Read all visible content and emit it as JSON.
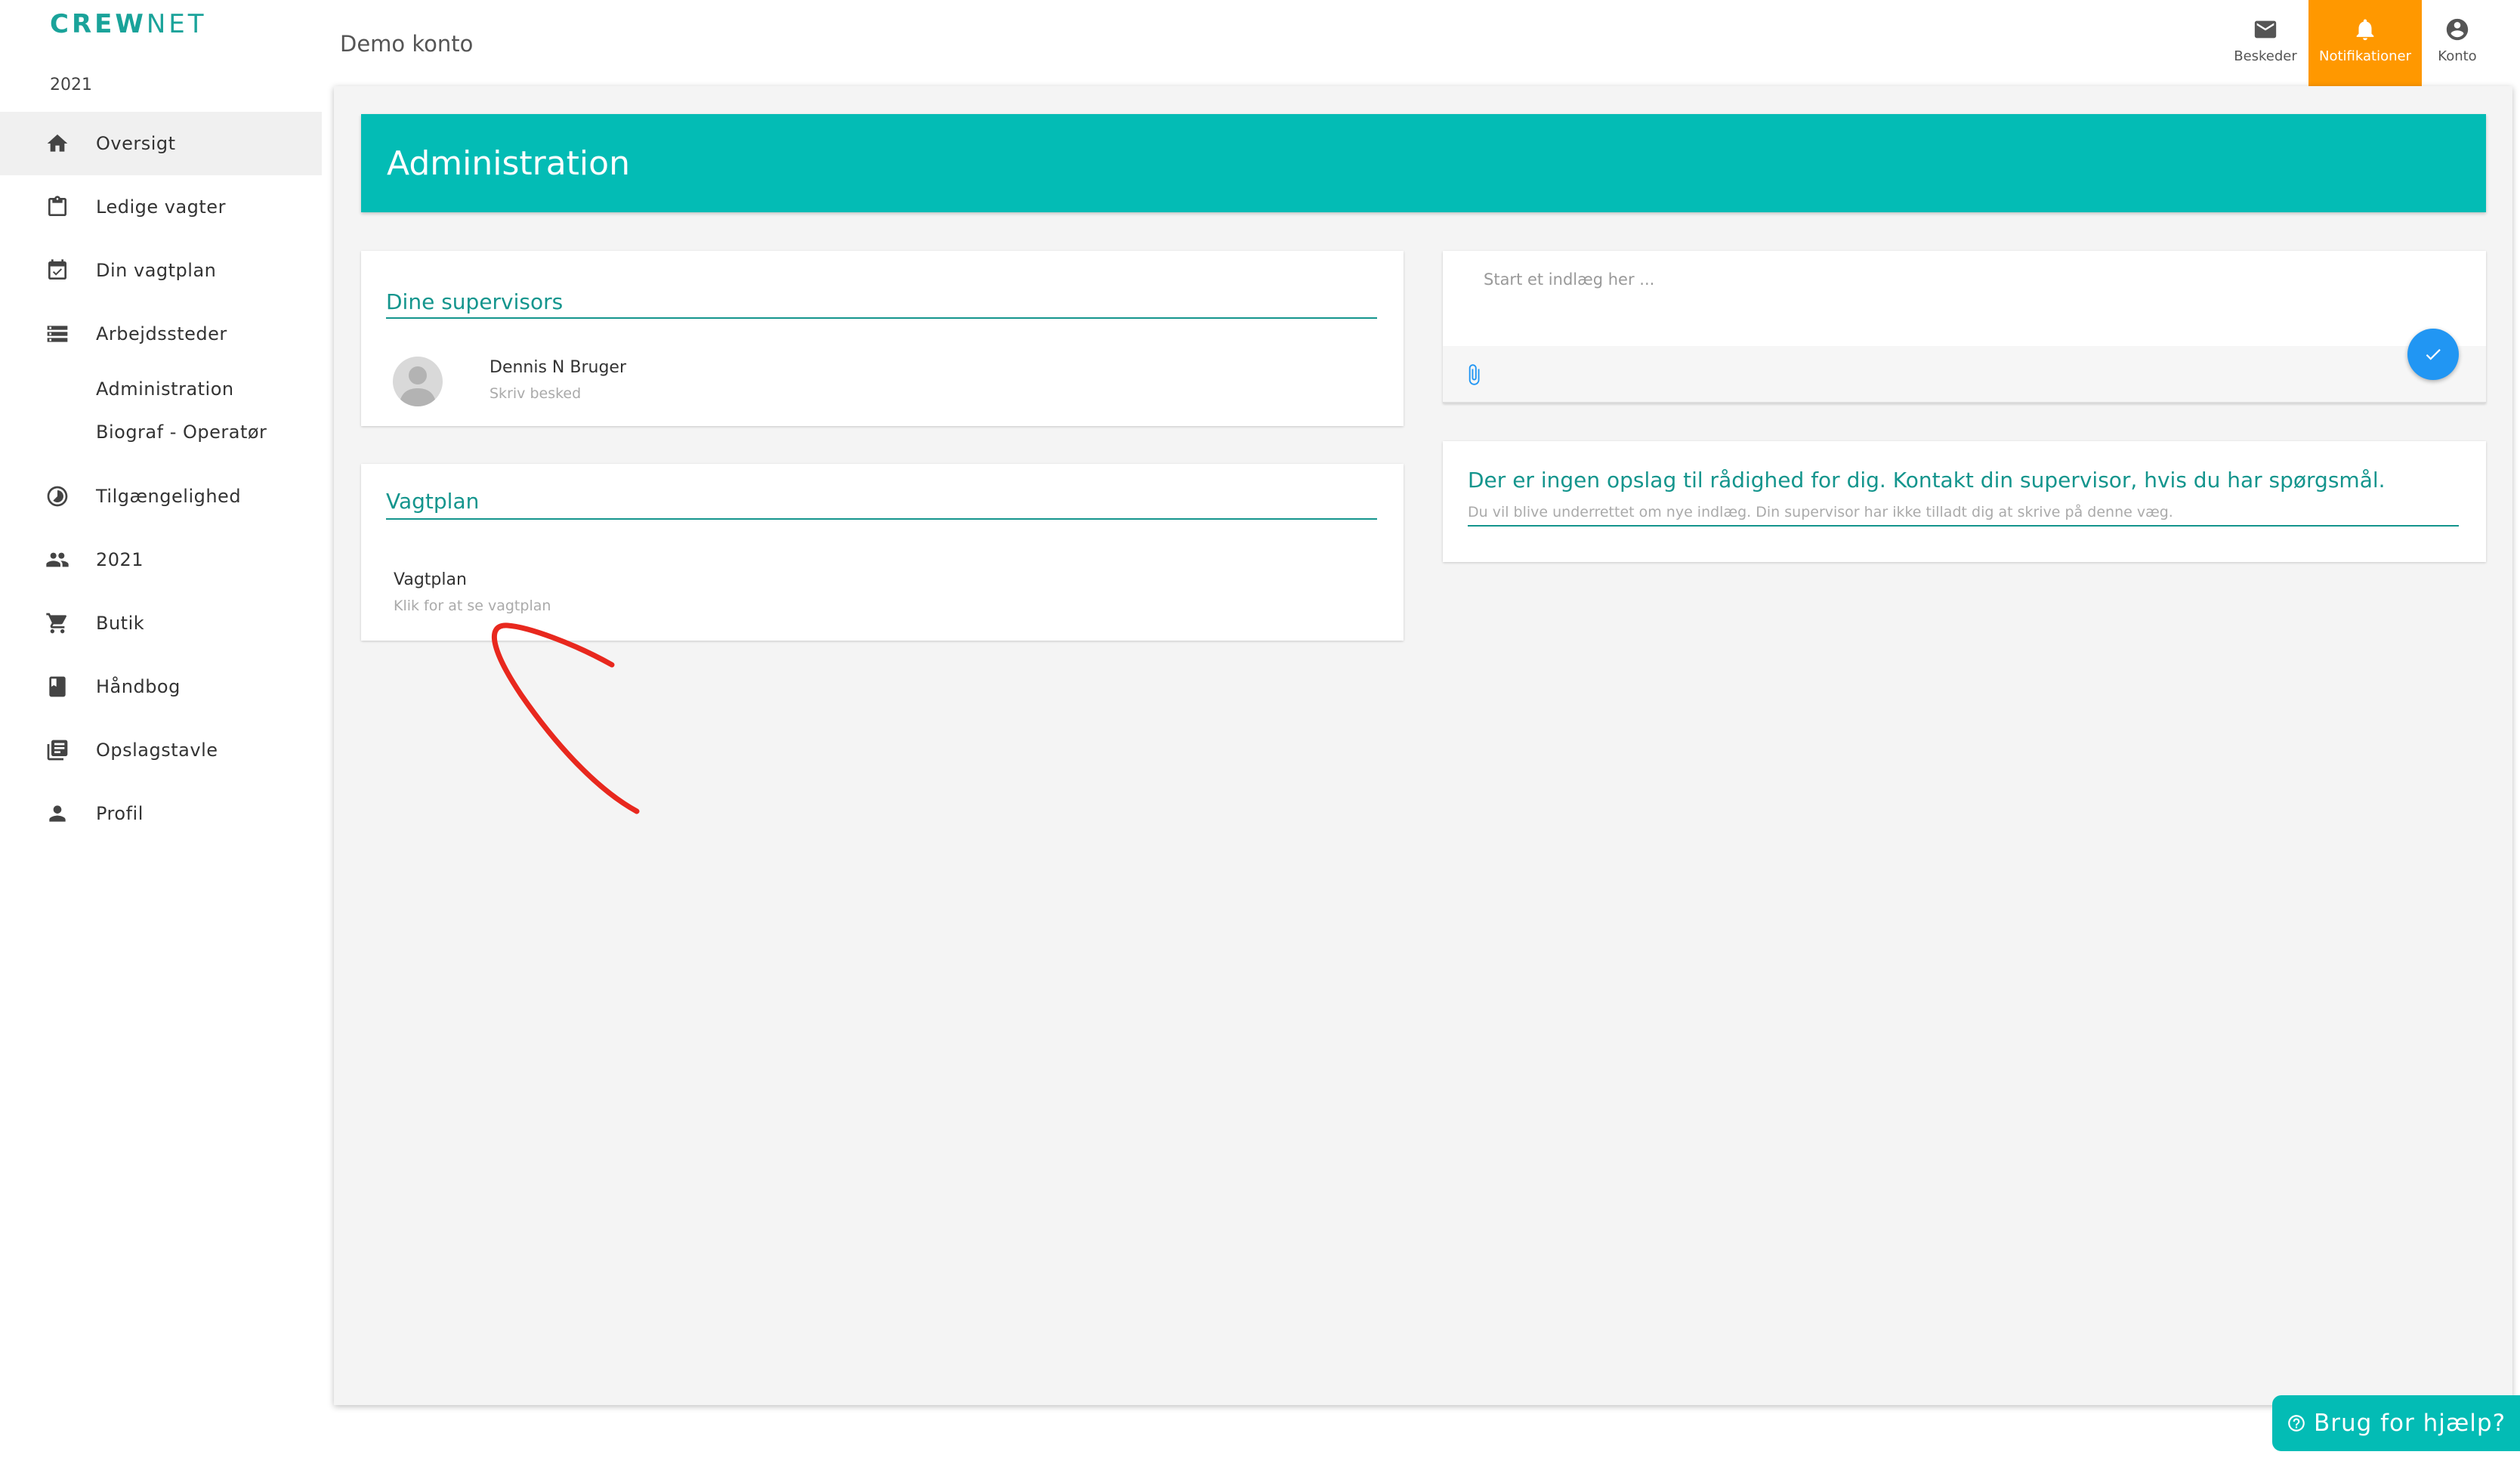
{
  "brand": {
    "logo_bold": "CREW",
    "logo_light": "NET",
    "accent": "#1aa39a"
  },
  "sidebar": {
    "year": "2021",
    "items": [
      {
        "label": "Oversigt",
        "icon": "home-icon",
        "active": true
      },
      {
        "label": "Ledige vagter",
        "icon": "clipboard-icon"
      },
      {
        "label": "Din vagtplan",
        "icon": "calendar-check-icon"
      },
      {
        "label": "Arbejdssteder",
        "icon": "storage-icon"
      },
      {
        "label": "Tilgængelighed",
        "icon": "timelapse-icon"
      },
      {
        "label": "2021",
        "icon": "people-icon"
      },
      {
        "label": "Butik",
        "icon": "cart-icon"
      },
      {
        "label": "Håndbog",
        "icon": "book-icon"
      },
      {
        "label": "Opslagstavle",
        "icon": "library-books-icon"
      },
      {
        "label": "Profil",
        "icon": "person-icon"
      }
    ],
    "sub_items": [
      "Administration",
      "Biograf - Operatør"
    ]
  },
  "header": {
    "account_name": "Demo konto",
    "messages_label": "Beskeder",
    "notifications_label": "Notifikationer",
    "account_label": "Konto",
    "notifications_color": "#ff9800"
  },
  "main": {
    "banner_title": "Administration",
    "banner_color": "#03bcb5",
    "supervisors": {
      "heading": "Dine supervisors",
      "name": "Dennis N Bruger",
      "action": "Skriv besked"
    },
    "schedule": {
      "heading": "Vagtplan",
      "item_title": "Vagtplan",
      "item_sub": "Klik for at se vagtplan"
    },
    "post": {
      "placeholder": "Start et indlæg her ...",
      "send_color": "#2196f3"
    },
    "info": {
      "title": "Der er ingen opslag til rådighed for dig. Kontakt din supervisor, hvis du har spørgsmål.",
      "subtitle": "Du vil blive underrettet om nye indlæg. Din supervisor har ikke tilladt dig at skrive på denne væg."
    }
  },
  "help": {
    "label": "Brug for hjælp?"
  },
  "annotation": {
    "color": "#e8281e"
  }
}
